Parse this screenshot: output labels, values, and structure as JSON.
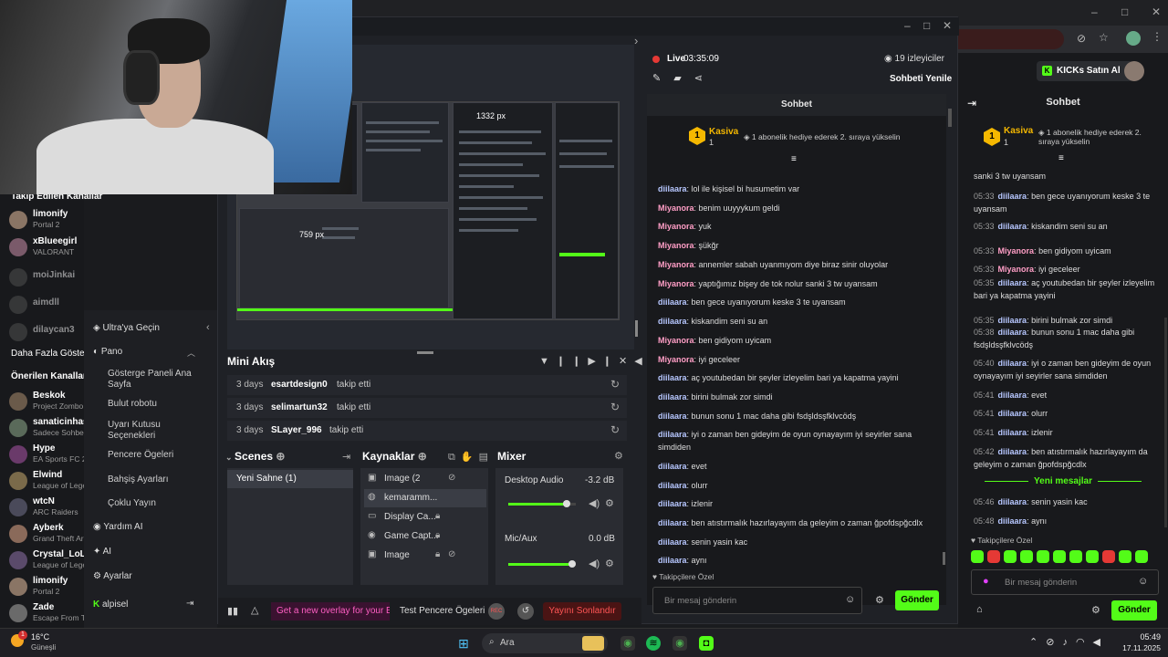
{
  "browser": {
    "win_controls": [
      "–",
      "□",
      "✕"
    ]
  },
  "kick_top": {
    "buy_label": "KICKs Satın Al"
  },
  "left_sidebar": {
    "followed_header": "Takip Edilen Kanallar",
    "followed": [
      {
        "name": "limonify",
        "game": "Portal 2"
      },
      {
        "name": "xBlueegirl",
        "game": "VALORANT"
      },
      {
        "name": "moiJinkai",
        "game": ""
      },
      {
        "name": "aimdll",
        "game": ""
      },
      {
        "name": "dilaycan3",
        "game": ""
      }
    ],
    "more_label": "Daha Fazla Göster",
    "suggested_header": "Önerilen Kanallar",
    "suggested": [
      {
        "name": "Beskok",
        "game": "Project Zombo"
      },
      {
        "name": "sanaticinhas",
        "game": "Sadece Sohbe"
      },
      {
        "name": "Hype",
        "game": "EA Sports FC 2"
      },
      {
        "name": "Elwind",
        "game": "League of Lege"
      },
      {
        "name": "wtcN",
        "game": "ARC Raiders"
      },
      {
        "name": "Ayberk",
        "game": "Grand Theft Ar"
      },
      {
        "name": "Crystal_LoL",
        "game": "League of Lege"
      },
      {
        "name": "limonify",
        "game": "Portal 2"
      },
      {
        "name": "Zade",
        "game": "Escape From T"
      }
    ]
  },
  "menu": {
    "upgrade": "Ultra'ya Geçin",
    "pano": "Pano",
    "sub": [
      "Gösterge Paneli Ana Sayfa",
      "Bulut robotu",
      "Uyarı Kutusu Seçenekleri",
      "Pencere Ögeleri",
      "Bahşiş Ayarları",
      "Çoklu Yayın"
    ],
    "help": "Yardım AI",
    "ai": "AI",
    "settings": "Ayarlar",
    "user": "alpisel"
  },
  "obs": {
    "live_label": "Live",
    "live_time": "03:35:09",
    "viewers": "19 izleyiciler",
    "refresh": "Sohbeti Yenile",
    "preview_px1": "1332 px",
    "preview_px2": "759 px",
    "mini_feed_title": "Mini Akış",
    "feed": [
      {
        "time": "3 days",
        "user": "esartdesign0",
        "action": "takip etti"
      },
      {
        "time": "3 days",
        "user": "selimartun32",
        "action": "takip etti"
      },
      {
        "time": "3 days",
        "user": "SLayer_996",
        "action": "takip etti"
      }
    ],
    "scenes_title": "Scenes",
    "scenes": [
      "Yeni Sahne (1)"
    ],
    "sources_title": "Kaynaklar",
    "sources": [
      {
        "icon": "▣",
        "name": "Image (2"
      },
      {
        "icon": "◍",
        "name": "kemaramm..."
      },
      {
        "icon": "▭",
        "name": "Display Ca..."
      },
      {
        "icon": "◉",
        "name": "Game Capt..."
      },
      {
        "icon": "▣",
        "name": "Image"
      }
    ],
    "mixer_title": "Mixer",
    "mixer": [
      {
        "name": "Desktop Audio",
        "db": "-3.2 dB",
        "level": 0.9
      },
      {
        "name": "Mic/Aux",
        "db": "0.0 dB",
        "level": 0.94
      }
    ],
    "bottom": {
      "overlay_ad": "Get a new overlay for your Bla",
      "test_label": "Test Pencere Ögeleri",
      "end_label": "Yayını Sonlandır",
      "rec": "REC"
    }
  },
  "obs_chat": {
    "title": "Sohbet",
    "top_user": "Kasiva",
    "top_user_count": "1",
    "top_msg": "1 abonelik hediye ederek 2. sıraya yükselin",
    "messages": [
      {
        "user": "diilaara",
        "text": "lol ile kişisel bi husumetim var",
        "c": "blue"
      },
      {
        "user": "Miyanora",
        "text": "benim uuyyykum geldi",
        "c": "pink"
      },
      {
        "user": "Miyanora",
        "text": "yuk",
        "c": "pink"
      },
      {
        "user": "Miyanora",
        "text": "şükğr",
        "c": "pink"
      },
      {
        "user": "Miyanora",
        "text": "annemler sabah uyanmıyom diye biraz sinir oluyolar",
        "c": "pink"
      },
      {
        "user": "Miyanora",
        "text": "yaptığımız bişey de tok nolur sanki 3 tw uyansam",
        "c": "pink"
      },
      {
        "user": "diilaara",
        "text": "ben gece uyanıyorum keske 3 te uyansam",
        "c": "blue"
      },
      {
        "user": "diilaara",
        "text": "kiskandim seni su an",
        "c": "blue"
      },
      {
        "user": "Miyanora",
        "text": "ben gidiyom uyicam",
        "c": "pink"
      },
      {
        "user": "Miyanora",
        "text": "iyi geceleer",
        "c": "pink"
      },
      {
        "user": "diilaara",
        "text": "aç youtubedan bir şeyler izleyelim bari ya kapatma yayini",
        "c": "blue"
      },
      {
        "user": "diilaara",
        "text": "birini bulmak zor simdi",
        "c": "blue"
      },
      {
        "user": "diilaara",
        "text": "bunun sonu 1 mac daha gibi fsdşldsşfklvcödş",
        "c": "blue"
      },
      {
        "user": "diilaara",
        "text": "iyi o zaman ben gideyim de oyun oynayayım iyi seyirler sana simdiden",
        "c": "blue"
      },
      {
        "user": "diilaara",
        "text": "evet",
        "c": "blue"
      },
      {
        "user": "diilaara",
        "text": "olurr",
        "c": "blue"
      },
      {
        "user": "diilaara",
        "text": "izlenir",
        "c": "blue"
      },
      {
        "user": "diilaara",
        "text": "ben atıstırmalık hazırlayayım da geleyim o zaman ğpofdspğcdlx",
        "c": "blue"
      },
      {
        "user": "diilaara",
        "text": "senin yasin kac",
        "c": "blue"
      },
      {
        "user": "diilaara",
        "text": "aynı",
        "c": "blue"
      }
    ],
    "followers_only": "Takipçilere Özel",
    "placeholder": "Bir mesaj gönderin",
    "send": "Gönder"
  },
  "right_chat": {
    "title": "Sohbet",
    "top_user": "Kasiva",
    "top_user_count": "1",
    "top_msg": "1 abonelik hediye ederek 2. sıraya yükselin",
    "first_partial": "sanki 3 tw uyansam",
    "messages": [
      {
        "ts": "05:33",
        "user": "diilaara",
        "text": "ben gece uyanıyorum keske 3 te uyansam",
        "c": "blue"
      },
      {
        "ts": "05:33",
        "user": "diilaara",
        "text": "kiskandim seni su an",
        "c": "blue"
      },
      {
        "ts": "05:33",
        "user": "Miyanora",
        "text": "ben gidiyom uyicam",
        "c": "pink"
      },
      {
        "ts": "05:33",
        "user": "Miyanora",
        "text": "iyi geceleer",
        "c": "pink"
      },
      {
        "ts": "05:35",
        "user": "diilaara",
        "text": "aç youtubedan bir şeyler izleyelim bari ya kapatma yayini",
        "c": "blue"
      },
      {
        "ts": "05:35",
        "user": "diilaara",
        "text": "birini bulmak zor simdi",
        "c": "blue"
      },
      {
        "ts": "05:38",
        "user": "diilaara",
        "text": "bunun sonu 1 mac daha gibi fsdşldsşfklvcödş",
        "c": "blue"
      },
      {
        "ts": "05:40",
        "user": "diilaara",
        "text": "iyi o zaman ben gideyim de oyun oynayayım iyi seyirler sana simdiden",
        "c": "blue"
      },
      {
        "ts": "05:41",
        "user": "diilaara",
        "text": "evet",
        "c": "blue"
      },
      {
        "ts": "05:41",
        "user": "diilaara",
        "text": "olurr",
        "c": "blue"
      },
      {
        "ts": "05:41",
        "user": "diilaara",
        "text": "izlenir",
        "c": "blue"
      },
      {
        "ts": "05:42",
        "user": "diilaara",
        "text": "ben atıstırmalık hazırlayayım da geleyim o zaman ğpofdspğcdlx",
        "c": "blue"
      }
    ],
    "new_messages": "Yeni mesajlar",
    "after": [
      {
        "ts": "05:46",
        "user": "diilaara",
        "text": "senin yasin kac",
        "c": "blue"
      },
      {
        "ts": "05:48",
        "user": "diilaara",
        "text": "aynı",
        "c": "blue"
      }
    ],
    "followers_only": "Takipçilere Özel",
    "placeholder": "Bir mesaj gönderin",
    "send": "Gönder"
  },
  "taskbar": {
    "weather_temp": "16°C",
    "weather_desc": "Güneşli",
    "weather_badge": "1",
    "search": "Ara",
    "time": "05:49",
    "date": "17.11.2025"
  },
  "colors": {
    "kick_green": "#53fc18",
    "name_blue": "#b7c7ff",
    "name_pink": "#ff9ec6"
  }
}
